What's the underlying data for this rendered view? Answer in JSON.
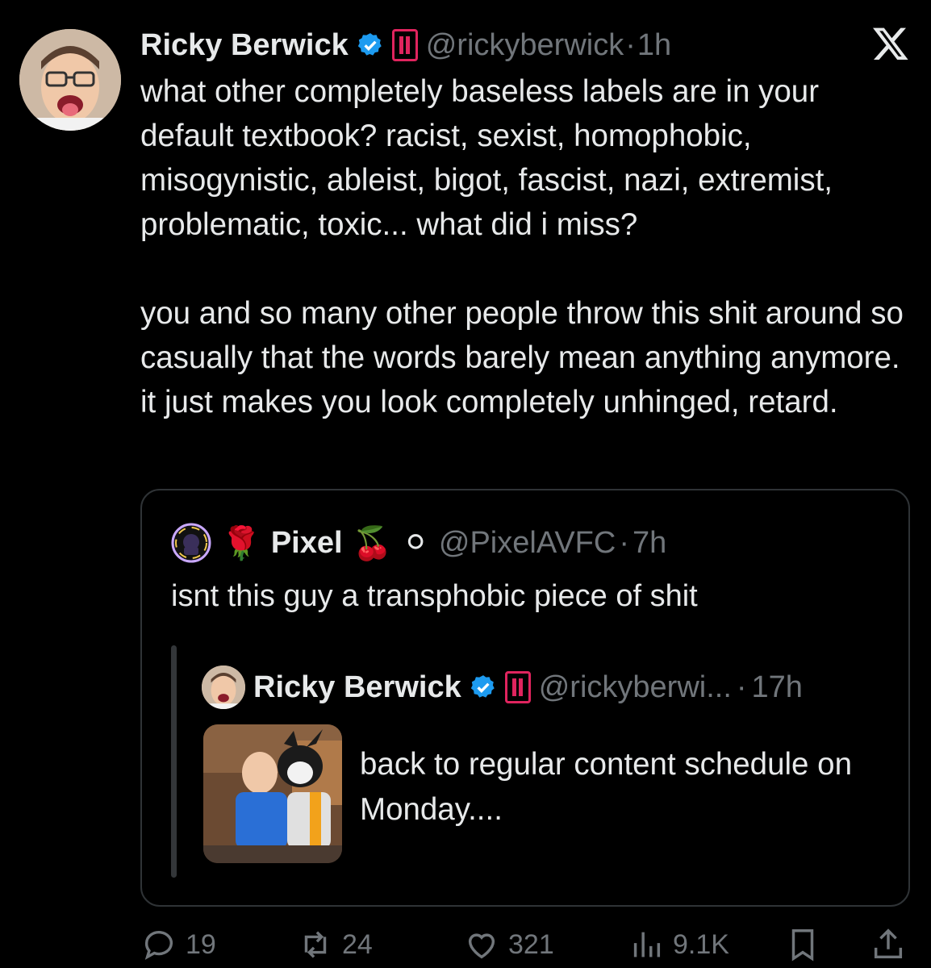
{
  "tweet": {
    "author_name": "Ricky Berwick",
    "handle": "@rickyberwick",
    "separator": "·",
    "time": "1h",
    "avatar_icon": "user-avatar-photo",
    "paragraphs": [
      "what other completely baseless labels are in your default textbook? racist, sexist, homophobic, misogynistic, ableist, bigot, fascist, nazi, extremist, problematic, toxic... what did i miss?",
      "you and so many other people throw this shit around so casually that the words barely mean anything anymore. it just makes you look completely unhinged, retard."
    ]
  },
  "quote": {
    "author_name": "Pixel",
    "emoji_rose": "🌹",
    "emoji_cherries": "🍒",
    "emoji_circle": "⚪",
    "handle": "@PixelAVFC",
    "separator": "·",
    "time": "7h",
    "text": "isnt this guy a transphobic piece of shit",
    "inner": {
      "author_name": "Ricky Berwick",
      "handle": "@rickyberwi...",
      "separator": "·",
      "time": "17h",
      "text": "back to regular content schedule on Monday...."
    }
  },
  "actions": {
    "replies": "19",
    "reposts": "24",
    "likes": "321",
    "views": "9.1K"
  },
  "colors": {
    "background": "#000000",
    "text": "#e7e9ea",
    "muted": "#71767b",
    "verified": "#1d9bf0",
    "badge": "#e0245e",
    "border": "#2f3336"
  }
}
